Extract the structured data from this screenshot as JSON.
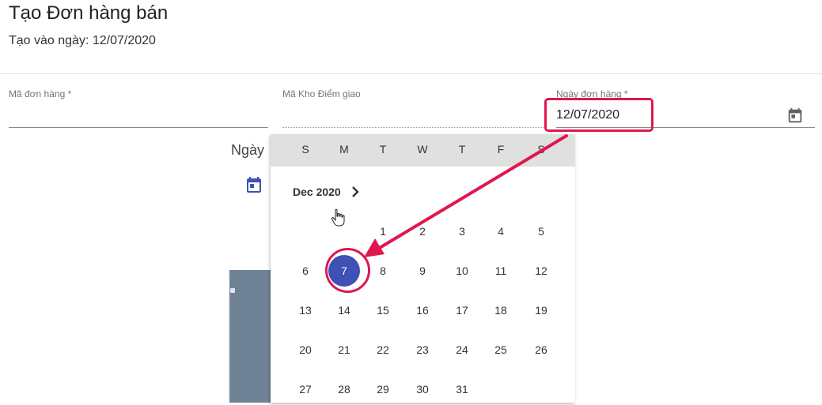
{
  "header": {
    "title": "Tạo Đơn hàng bán",
    "subtitle": "Tạo vào ngày: 12/07/2020"
  },
  "form": {
    "order_code": {
      "label": "Mã đơn hàng *",
      "value": ""
    },
    "warehouse": {
      "label": "Mã Kho Điểm giao",
      "value": ""
    },
    "order_date": {
      "label": "Ngày đơn hàng *",
      "value": "12/07/2020",
      "icon": "calendar-icon"
    }
  },
  "background": {
    "label_fragment": "Ngày",
    "icon": "calendar-icon"
  },
  "calendar": {
    "weekdays": [
      "S",
      "M",
      "T",
      "W",
      "T",
      "F",
      "S"
    ],
    "month_label": "Dec 2020",
    "next_icon": "chevron-right-icon",
    "selected_day": 7,
    "weeks": [
      [
        "",
        "",
        "1",
        "2",
        "3",
        "4",
        "5"
      ],
      [
        "6",
        "7",
        "8",
        "9",
        "10",
        "11",
        "12"
      ],
      [
        "13",
        "14",
        "15",
        "16",
        "17",
        "18",
        "19"
      ],
      [
        "20",
        "21",
        "22",
        "23",
        "24",
        "25",
        "26"
      ],
      [
        "27",
        "28",
        "29",
        "30",
        "31",
        "",
        ""
      ]
    ]
  },
  "colors": {
    "accent": "#3f51b5",
    "annotation": "#e0174e"
  }
}
